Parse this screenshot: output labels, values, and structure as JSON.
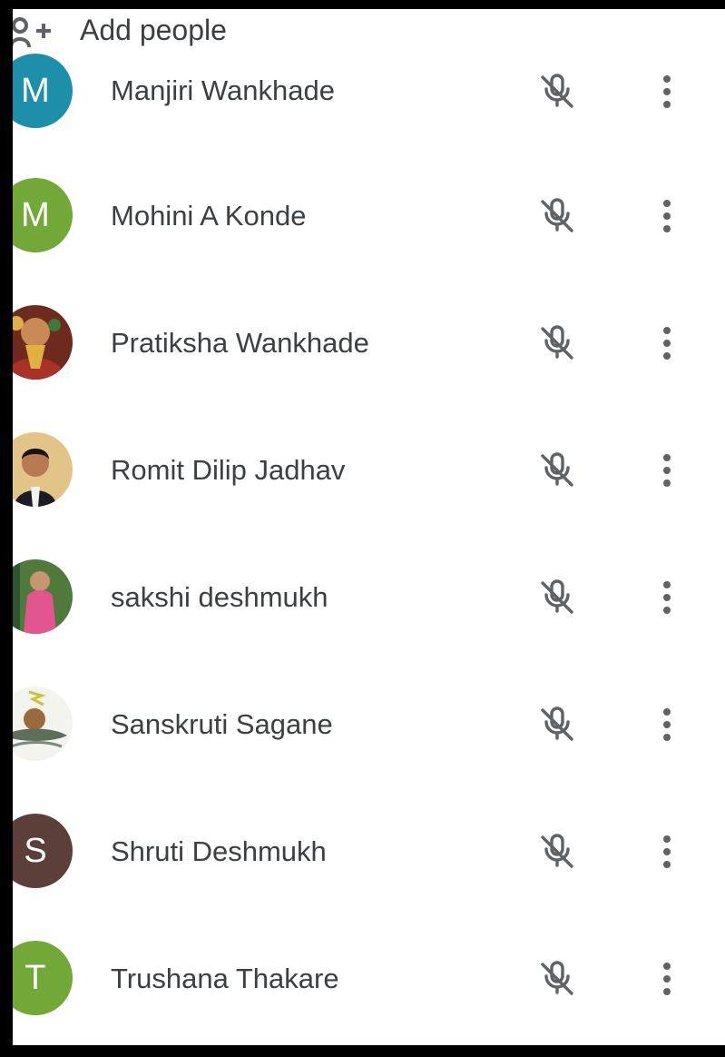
{
  "header": {
    "add_people_label": "Add people",
    "add_people_icon": "person-add-icon"
  },
  "participants": [
    {
      "name": "Manjiri Wankhade",
      "initial": "M",
      "avatar_color": "#1e8fa8",
      "avatar_type": "initial",
      "mic": "mic-off-icon"
    },
    {
      "name": "Mohini A Konde",
      "initial": "M",
      "avatar_color": "#72a837",
      "avatar_type": "initial",
      "mic": "mic-off-icon"
    },
    {
      "name": "Pratiksha Wankhade",
      "initial": "",
      "avatar_color": "#8a3b2a",
      "avatar_type": "photo",
      "mic": "mic-off-icon"
    },
    {
      "name": "Romit Dilip Jadhav",
      "initial": "",
      "avatar_color": "#b58a4c",
      "avatar_type": "photo",
      "mic": "mic-off-icon"
    },
    {
      "name": "sakshi deshmukh",
      "initial": "",
      "avatar_color": "#d9528e",
      "avatar_type": "photo",
      "mic": "mic-off-icon"
    },
    {
      "name": "Sanskruti Sagane",
      "initial": "",
      "avatar_color": "#e8e8e0",
      "avatar_type": "photo",
      "mic": "mic-off-icon"
    },
    {
      "name": "Shruti Deshmukh",
      "initial": "S",
      "avatar_color": "#5b3f38",
      "avatar_type": "initial",
      "mic": "mic-off-icon"
    },
    {
      "name": "Trushana Thakare",
      "initial": "T",
      "avatar_color": "#72a837",
      "avatar_type": "initial",
      "mic": "mic-off-icon"
    }
  ],
  "colors": {
    "text": "#3c4043",
    "icon": "#5f6368",
    "frame": "#000000"
  }
}
